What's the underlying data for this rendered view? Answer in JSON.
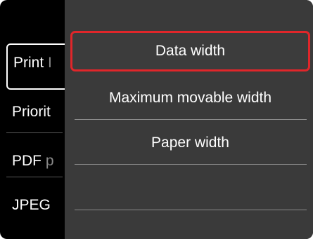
{
  "background_menu": {
    "items": [
      {
        "visible_text": "Print",
        "faded_text": " I"
      },
      {
        "visible_text": "Priorit",
        "faded_text": ""
      },
      {
        "visible_text": "PDF",
        "faded_text": " p"
      },
      {
        "visible_text": "JPEG",
        "faded_text": ""
      }
    ]
  },
  "popup": {
    "options": [
      {
        "label": "Data width",
        "selected": true
      },
      {
        "label": "Maximum movable width",
        "selected": false
      },
      {
        "label": "Paper width",
        "selected": false
      }
    ],
    "highlight_color": "#e0262a",
    "panel_color": "#3a3a3a"
  }
}
